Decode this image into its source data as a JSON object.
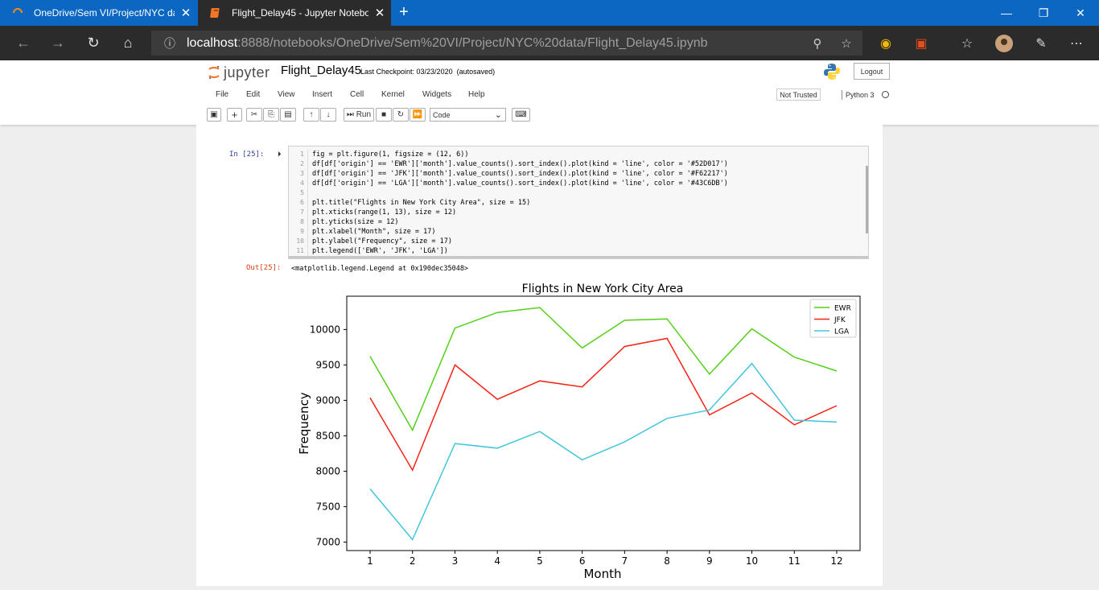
{
  "browser": {
    "tabs": [
      {
        "title": "OneDrive/Sem VI/Project/NYC da",
        "active": false
      },
      {
        "title": "Flight_Delay45 - Jupyter Notebo",
        "active": true
      }
    ],
    "url_host": "localhost",
    "url_rest": ":8888/notebooks/OneDrive/Sem%20VI/Project/NYC%20data/Flight_Delay45.ipynb"
  },
  "jupyter": {
    "logo_text": "jupyter",
    "notebook_name": "Flight_Delay45",
    "checkpoint": "Last Checkpoint: 03/23/2020",
    "autosaved": "(autosaved)",
    "logout_label": "Logout",
    "menu": [
      "File",
      "Edit",
      "View",
      "Insert",
      "Cell",
      "Kernel",
      "Widgets",
      "Help"
    ],
    "not_trusted": "Not Trusted",
    "kernel": "Python 3",
    "run_label": "Run",
    "cell_type": "Code"
  },
  "cell": {
    "in_prompt": "In [25]:",
    "out_prompt": "Out[25]:",
    "line_numbers": [
      "1",
      "2",
      "3",
      "4",
      "5",
      "6",
      "7",
      "8",
      "9",
      "10",
      "11"
    ],
    "code": [
      "fig = plt.figure(1, figsize = (12, 6))",
      "df[df['origin'] == 'EWR']['month'].value_counts().sort_index().plot(kind = 'line', color = '#52D017')",
      "df[df['origin'] == 'JFK']['month'].value_counts().sort_index().plot(kind = 'line', color = '#F62217')",
      "df[df['origin'] == 'LGA']['month'].value_counts().sort_index().plot(kind = 'line', color = '#43C6DB')",
      "",
      "plt.title(\"Flights in New York City Area\", size = 15)",
      "plt.xticks(range(1, 13), size = 12)",
      "plt.yticks(size = 12)",
      "plt.xlabel(\"Month\", size = 17)",
      "plt.ylabel(\"Frequency\", size = 17)",
      "plt.legend(['EWR', 'JFK', 'LGA'])"
    ],
    "output_text": "<matplotlib.legend.Legend at 0x190dec35048>"
  },
  "chart_data": {
    "type": "line",
    "title": "Flights in New York City Area",
    "xlabel": "Month",
    "ylabel": "Frequency",
    "x": [
      1,
      2,
      3,
      4,
      5,
      6,
      7,
      8,
      9,
      10,
      11,
      12
    ],
    "xticks": [
      "1",
      "2",
      "3",
      "4",
      "5",
      "6",
      "7",
      "8",
      "9",
      "10",
      "11",
      "12"
    ],
    "yticks": [
      7000,
      7500,
      8000,
      8500,
      9000,
      9500,
      10000
    ],
    "xlim": [
      0.45,
      12.55
    ],
    "ylim": [
      6880,
      10470
    ],
    "legend_position": "top-right",
    "grid": false,
    "series": [
      {
        "name": "EWR",
        "color": "#52D017",
        "values": [
          9620,
          8580,
          10020,
          10240,
          10310,
          9740,
          10130,
          10150,
          9370,
          10010,
          9610,
          9415
        ]
      },
      {
        "name": "JFK",
        "color": "#F62217",
        "values": [
          9035,
          8015,
          9500,
          9015,
          9275,
          9190,
          9760,
          9875,
          8795,
          9105,
          8655,
          8925
        ]
      },
      {
        "name": "LGA",
        "color": "#43C6DB",
        "values": [
          7750,
          7035,
          8390,
          8325,
          8560,
          8160,
          8415,
          8745,
          8865,
          9520,
          8720,
          8695
        ]
      }
    ]
  }
}
